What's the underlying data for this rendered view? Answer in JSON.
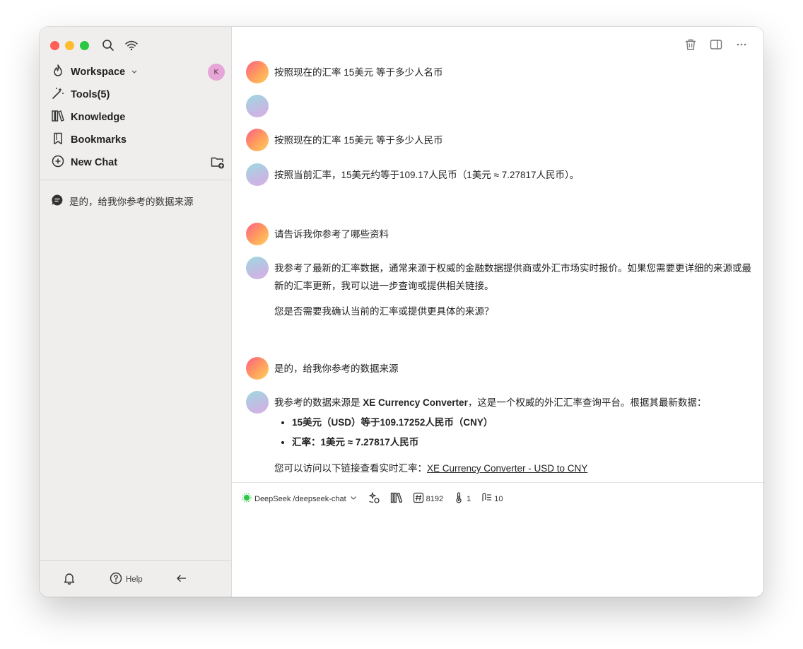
{
  "sidebar": {
    "workspace_label": "Workspace",
    "user_initial": "K",
    "tools_label": "Tools(5)",
    "knowledge_label": "Knowledge",
    "bookmarks_label": "Bookmarks",
    "new_chat_label": "New Chat",
    "history": [
      {
        "title": "是的，给我你参考的数据来源"
      }
    ],
    "help_label": "Help"
  },
  "messages": [
    {
      "role": "user",
      "text": "按照现在的汇率 15美元 等于多少人名币"
    },
    {
      "role": "assistant",
      "text": ""
    },
    {
      "role": "user",
      "text": "按照现在的汇率 15美元 等于多少人民币"
    },
    {
      "role": "assistant",
      "text": "按照当前汇率，15美元约等于109.17人民币（1美元 ≈ 7.27817人民币）。"
    },
    {
      "role": "user",
      "text": "请告诉我你参考了哪些资料"
    },
    {
      "role": "assistant",
      "p1": "我参考了最新的汇率数据，通常来源于权威的金融数据提供商或外汇市场实时报价。如果您需要更详细的来源或最新的汇率更新，我可以进一步查询或提供相关链接。",
      "p2": "您是否需要我确认当前的汇率或提供更具体的来源？"
    },
    {
      "role": "user",
      "text": "是的，给我你参考的数据来源"
    },
    {
      "role": "assistant",
      "p1_prefix": "我参考的数据来源是 ",
      "p1_bold": "XE Currency Converter",
      "p1_suffix": "，这是一个权威的外汇汇率查询平台。根据其最新数据：",
      "bullets": [
        "15美元（USD）等于109.17252人民币（CNY）",
        "汇率：1美元 ≈ 7.27817人民币"
      ],
      "p2_prefix": "您可以访问以下链接查看实时汇率：",
      "link_text": "XE Currency Converter - USD to CNY"
    }
  ],
  "composer": {
    "model_label": "DeepSeek /deepseek-chat",
    "max_tokens": "8192",
    "temperature": "1",
    "context_count": "10"
  },
  "colors": {
    "close": "#ff5f57",
    "minimize": "#febc2e",
    "zoom": "#28c840",
    "model_status": "#2fc84a",
    "sidebar_bg": "#efeeed"
  }
}
